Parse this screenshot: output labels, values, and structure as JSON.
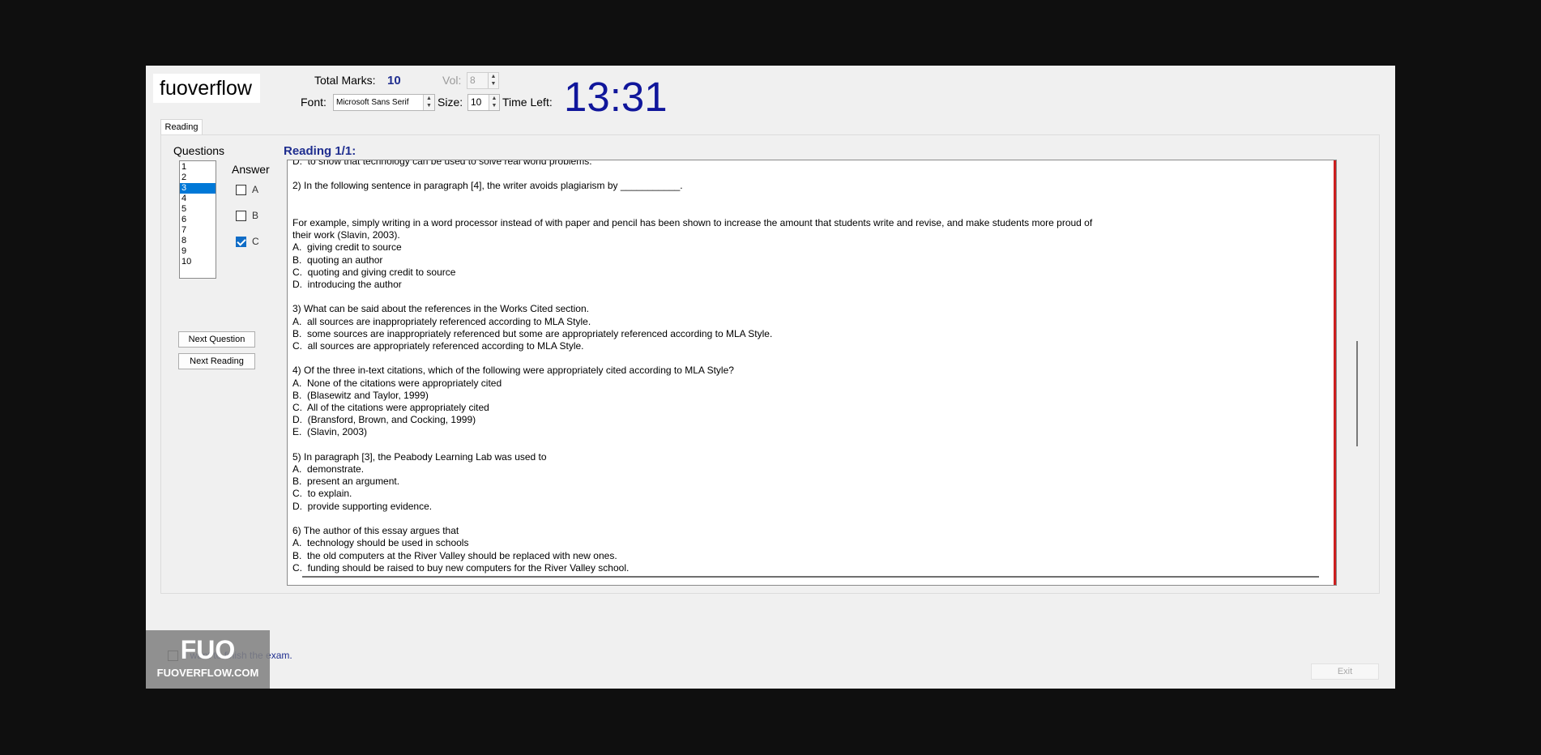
{
  "brand": "fuoverflow",
  "header": {
    "total_marks_label": "Total Marks:",
    "total_marks_value": "10",
    "vol_label": "Vol:",
    "vol_value": "8",
    "font_label": "Font:",
    "font_value": "Microsoft Sans Serif",
    "size_label": "Size:",
    "size_value": "10",
    "time_left_label": "Time Left:",
    "time_left_value": "13:31"
  },
  "tab": "Reading",
  "questions": {
    "label": "Questions",
    "items": [
      "1",
      "2",
      "3",
      "4",
      "5",
      "6",
      "7",
      "8",
      "9",
      "10"
    ],
    "selected": "3"
  },
  "answer": {
    "label": "Answer",
    "options": [
      {
        "label": "A",
        "checked": false
      },
      {
        "label": "B",
        "checked": false
      },
      {
        "label": "C",
        "checked": true
      }
    ]
  },
  "buttons": {
    "next_question": "Next Question",
    "next_reading": "Next Reading",
    "exit": "Exit"
  },
  "reading": {
    "title": "Reading 1/1:",
    "text": "D.  to show that technology can be used to solve real world problems.\n\n2) In the following sentence in paragraph [4], the writer avoids plagiarism by ___________.\n\n\nFor example, simply writing in a word processor instead of with paper and pencil has been shown to increase the amount that students write and revise, and make students more proud of\ntheir work (Slavin, 2003).\nA.  giving credit to source\nB.  quoting an author\nC.  quoting and giving credit to source\nD.  introducing the author\n\n3) What can be said about the references in the Works Cited section.\nA.  all sources are inappropriately referenced according to MLA Style.\nB.  some sources are inappropriately referenced but some are appropriately referenced according to MLA Style.\nC.  all sources are appropriately referenced according to MLA Style.\n\n4) Of the three in-text citations, which of the following were appropriately cited according to MLA Style?\nA.  None of the citations were appropriately cited\nB.  (Blasewitz and Taylor, 1999)\nC.  All of the citations were appropriately cited\nD.  (Bransford, Brown, and Cocking, 1999)\nE.  (Slavin, 2003)\n\n5) In paragraph [3], the Peabody Learning Lab was used to\nA.  demonstrate.\nB.  present an argument.\nC.  to explain.\nD.  provide supporting evidence.\n\n6) The author of this essay argues that\nA.  technology should be used in schools\nB.  the old computers at the River Valley should be replaced with new ones.\nC.  funding should be raised to buy new computers for the River Valley school."
  },
  "finish_label": "I want to finish the exam.",
  "watermark": {
    "logo": "FUO",
    "site": "FUOVERFLOW.COM"
  }
}
